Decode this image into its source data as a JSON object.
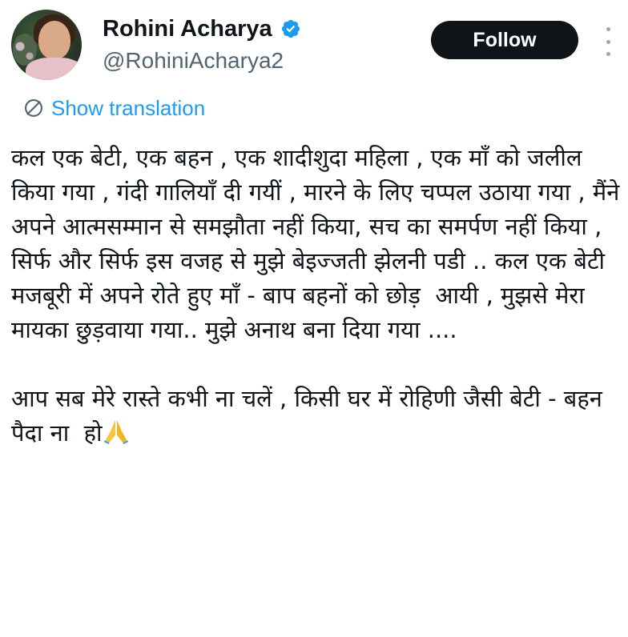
{
  "author": {
    "display_name": "Rohini Acharya",
    "handle": "@RohiniAcharya2",
    "verified": true
  },
  "header": {
    "follow_label": "Follow"
  },
  "translation": {
    "label": "Show translation"
  },
  "tweet": {
    "paragraph_1": "कल एक बेटी, एक बहन , एक शादीशुदा महिला , एक माँ को जलील किया गया , गंदी गालियाँ दी गयीं , मारने के लिए चप्पल उठाया गया , मैंने  अपने आत्मसम्मान से समझौता नहीं किया, सच का समर्पण नहीं किया , सिर्फ और सिर्फ इस वजह से मुझे बेइज्जती झेलनी पडी .. कल एक बेटी मजबूरी में अपने रोते हुए माँ - बाप बहनों को छोड़  आयी , मुझसे मेरा मायका छुड़वाया गया.. मुझे अनाथ बना दिया गया ....",
    "paragraph_2": "आप सब मेरे रास्ते कभी ना चलें , किसी घर में रोहिणी जैसी बेटी - बहन  पैदा ना  हो",
    "emoji": "folded-hands"
  },
  "colors": {
    "text": "#0f1419",
    "secondary": "#536471",
    "link": "#1d9bf0",
    "verified": "#1d9bf0",
    "follow_bg": "#0f1419"
  }
}
